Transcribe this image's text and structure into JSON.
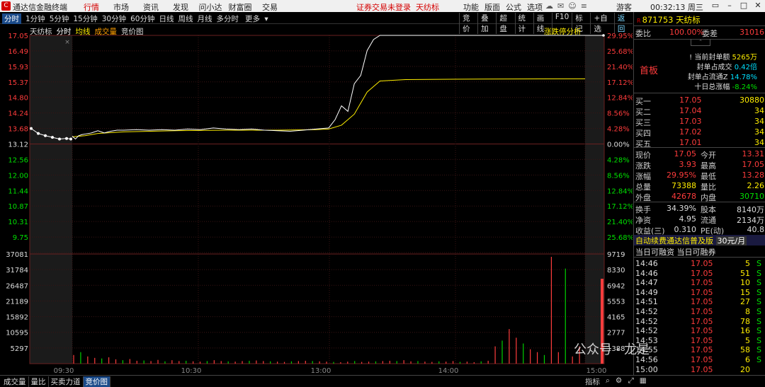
{
  "app": {
    "logo": "C",
    "name": "通达信金融终端"
  },
  "menu": [
    "行情",
    "市场",
    "资讯",
    "发现",
    "问小达",
    "财富圈",
    "交易"
  ],
  "notice": "证券交易未登录",
  "stock_title": "天纺标",
  "top_right": [
    "功能",
    "版面",
    "公式",
    "选项"
  ],
  "guest": "游客",
  "clock": "00:32:13 周三",
  "toolbar": {
    "tabs": [
      "分时",
      "1分钟",
      "5分钟",
      "15分钟",
      "30分钟",
      "60分钟",
      "日线",
      "周线",
      "月线",
      "多分时",
      "更多"
    ],
    "right": [
      "竞价",
      "叠加",
      "超盘",
      "统计",
      "画线",
      "F10",
      "标记",
      "+自选",
      "返回"
    ]
  },
  "subhead": {
    "name": "天纺标",
    "mode": "分时",
    "avg": "均线",
    "vol": "成交量",
    "auction": "竞价图"
  },
  "limit_btn": "涨跌停分析",
  "chart_data": {
    "type": "line",
    "price_axis": [
      "17.05",
      "16.49",
      "15.93",
      "15.37",
      "14.80",
      "14.24",
      "13.68",
      "13.12",
      "12.56",
      "12.00",
      "11.44",
      "10.87",
      "10.31",
      "9.75"
    ],
    "pct_axis": [
      "29.95%",
      "25.68%",
      "21.40%",
      "17.12%",
      "12.84%",
      "8.56%",
      "4.28%",
      "0.00%",
      "4.28%",
      "8.56%",
      "12.84%",
      "17.12%",
      "21.40%",
      "25.68%"
    ],
    "vol_axis_left": [
      "37081",
      "31784",
      "26487",
      "21189",
      "15892",
      "10595",
      "5297"
    ],
    "vol_axis_right": [
      "9719",
      "8330",
      "6942",
      "5553",
      "4165",
      "2777",
      "1388"
    ],
    "time_labels": [
      "09:30",
      "10:30",
      "13:00",
      "14:00",
      "15:00"
    ],
    "prev_close": 13.12,
    "ylim": [
      9.19,
      17.05
    ],
    "price": [
      [
        0,
        13.4
      ],
      [
        0.25,
        13.3
      ],
      [
        0.5,
        13.42
      ],
      [
        0.75,
        13.46
      ],
      [
        1,
        13.48
      ],
      [
        1.5,
        13.52
      ],
      [
        2,
        13.6
      ],
      [
        2.5,
        13.52
      ],
      [
        3,
        13.58
      ],
      [
        3.5,
        13.62
      ],
      [
        4,
        13.62
      ],
      [
        5,
        13.64
      ],
      [
        6,
        13.62
      ],
      [
        7,
        13.64
      ],
      [
        8,
        13.62
      ],
      [
        9,
        13.66
      ],
      [
        10,
        13.64
      ],
      [
        11,
        13.7
      ],
      [
        12,
        13.66
      ],
      [
        13,
        13.64
      ],
      [
        14,
        13.66
      ],
      [
        15,
        13.62
      ],
      [
        16,
        13.6
      ],
      [
        17,
        13.58
      ],
      [
        18,
        13.62
      ],
      [
        19,
        13.66
      ],
      [
        20,
        13.7
      ],
      [
        20.5,
        14.0
      ],
      [
        21,
        14.5
      ],
      [
        21.5,
        14.3
      ],
      [
        22,
        15.3
      ],
      [
        22.5,
        15.6
      ],
      [
        23,
        16.5
      ],
      [
        23.5,
        16.9
      ],
      [
        24,
        17.05
      ],
      [
        40,
        17.05
      ]
    ],
    "avg": [
      [
        0,
        13.38
      ],
      [
        1,
        13.42
      ],
      [
        2,
        13.5
      ],
      [
        4,
        13.56
      ],
      [
        8,
        13.6
      ],
      [
        12,
        13.62
      ],
      [
        16,
        13.62
      ],
      [
        19,
        13.64
      ],
      [
        20,
        13.66
      ],
      [
        21,
        13.8
      ],
      [
        22,
        14.2
      ],
      [
        23,
        15.0
      ],
      [
        24,
        15.4
      ],
      [
        26,
        15.45
      ],
      [
        32,
        15.47
      ],
      [
        40,
        15.48
      ]
    ],
    "volume": [
      3000,
      4000,
      2500,
      2000,
      1800,
      2200,
      1500,
      1200,
      1600,
      1000,
      1100,
      900,
      1300,
      800,
      1200,
      900,
      1000,
      800,
      700,
      900,
      1200,
      900,
      800,
      700,
      900,
      1000,
      1100,
      900,
      800,
      700,
      600,
      800,
      900,
      1000,
      900,
      800,
      700,
      600,
      500,
      700,
      900,
      600,
      700,
      800,
      900,
      1000,
      900,
      1200,
      800,
      900,
      700,
      600,
      800,
      700,
      900,
      600,
      700,
      500,
      800,
      1000,
      6000,
      8000,
      12000,
      9000,
      7000,
      5000,
      4000,
      3000,
      37081,
      4000,
      33000,
      2500,
      6000
    ]
  },
  "panel": {
    "code": "871753",
    "name": "天纺标",
    "weibi_label": "委比",
    "weibi": "100.00%",
    "weicha_label": "委差",
    "weicha": "31016",
    "info": [
      {
        "label": "当前封单额",
        "value": "5265万"
      },
      {
        "label": "封单占成交",
        "value": "0.42倍"
      },
      {
        "label": "封单占流通Z",
        "value": "14.78%"
      },
      {
        "label": "十日总涨幅",
        "value": "-8.24%"
      }
    ],
    "board": "首板",
    "bids": [
      {
        "label": "买一",
        "price": "17.05",
        "vol": "30880"
      },
      {
        "label": "买二",
        "price": "17.04",
        "vol": "34"
      },
      {
        "label": "买三",
        "price": "17.03",
        "vol": "34"
      },
      {
        "label": "买四",
        "price": "17.02",
        "vol": "34"
      },
      {
        "label": "买五",
        "price": "17.01",
        "vol": "34"
      }
    ],
    "quote": [
      {
        "l1": "现价",
        "v1": "17.05",
        "c1": "red",
        "l2": "今开",
        "v2": "13.31",
        "c2": "red"
      },
      {
        "l1": "涨跌",
        "v1": "3.93",
        "c1": "red",
        "l2": "最高",
        "v2": "17.05",
        "c2": "red"
      },
      {
        "l1": "涨幅",
        "v1": "29.95%",
        "c1": "red",
        "l2": "最低",
        "v2": "13.28",
        "c2": "red"
      },
      {
        "l1": "总量",
        "v1": "73388",
        "c1": "yel",
        "l2": "量比",
        "v2": "2.26",
        "c2": "yel"
      },
      {
        "l1": "外盘",
        "v1": "42678",
        "c1": "red",
        "l2": "内盘",
        "v2": "30710",
        "c2": "grn"
      }
    ],
    "quote2": [
      {
        "l1": "换手",
        "v1": "34.39%",
        "l2": "股本",
        "v2": "8140万"
      },
      {
        "l1": "净资",
        "v1": "4.95",
        "l2": "流通",
        "v2": "2134万"
      },
      {
        "l1": "收益(三)",
        "v1": "0.310",
        "l2": "PE(动)",
        "v2": "40.8"
      }
    ],
    "banner": "自动续费通达信普及版",
    "banner_price": "30元/月",
    "margin": "当日可融资 当日可融券",
    "trades": [
      {
        "t": "14:46",
        "p": "17.05",
        "v": "5",
        "s": "S"
      },
      {
        "t": "14:46",
        "p": "17.05",
        "v": "51",
        "s": "S"
      },
      {
        "t": "14:47",
        "p": "17.05",
        "v": "10",
        "s": "S"
      },
      {
        "t": "14:49",
        "p": "17.05",
        "v": "15",
        "s": "S"
      },
      {
        "t": "14:51",
        "p": "17.05",
        "v": "27",
        "s": "S"
      },
      {
        "t": "14:52",
        "p": "17.05",
        "v": "8",
        "s": "S"
      },
      {
        "t": "14:52",
        "p": "17.05",
        "v": "78",
        "s": "S"
      },
      {
        "t": "14:52",
        "p": "17.05",
        "v": "16",
        "s": "S"
      },
      {
        "t": "14:53",
        "p": "17.05",
        "v": "5",
        "s": "S"
      },
      {
        "t": "14:55",
        "p": "17.05",
        "v": "58",
        "s": "S"
      },
      {
        "t": "14:56",
        "p": "17.05",
        "v": "6",
        "s": "S"
      },
      {
        "t": "15:00",
        "p": "17.05",
        "v": "20",
        "s": ""
      }
    ]
  },
  "bottom": {
    "tabs": [
      "成交量",
      "量比",
      "买卖力道",
      "竞价图"
    ],
    "right": "指标"
  },
  "watermark": "公众号 · 龙是"
}
